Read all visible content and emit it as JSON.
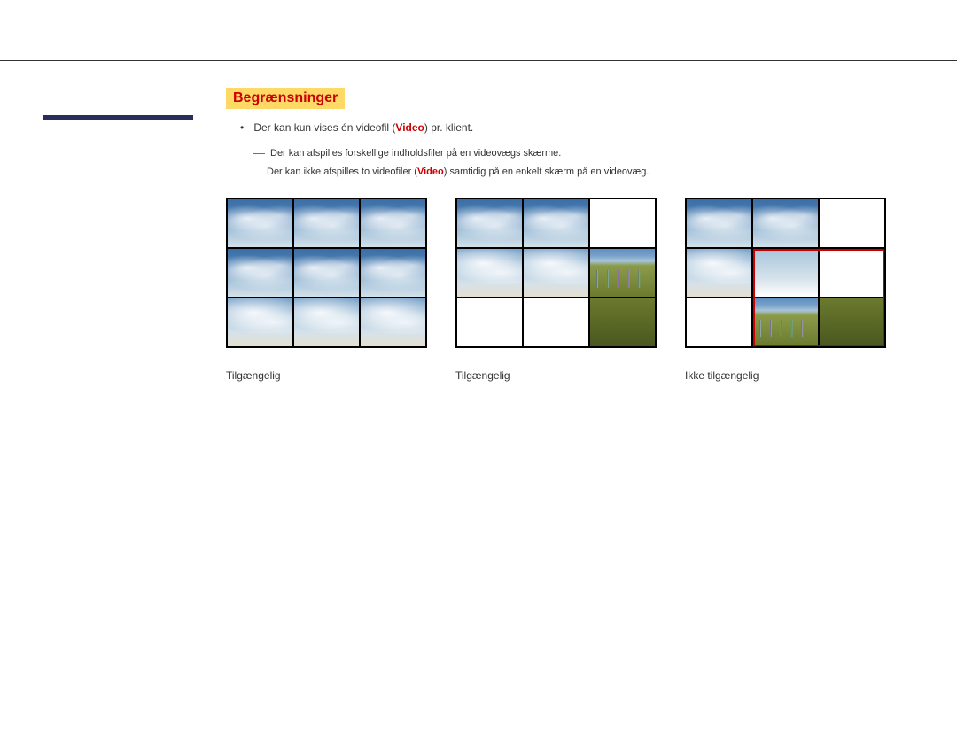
{
  "section_title": "Begrænsninger",
  "bullet": {
    "prefix": "Der kan kun vises én videofil (",
    "highlight": "Video",
    "suffix": ") pr. klient."
  },
  "sublist": {
    "line1": "Der kan afspilles forskellige indholdsfiler på en videovægs skærme.",
    "line2_prefix": "Der kan ikke afspilles to videofiler (",
    "line2_highlight": "Video",
    "line2_suffix": ") samtidig på en enkelt skærm på en videovæg."
  },
  "captions": {
    "fig1": "Tilgængelig",
    "fig2": "Tilgængelig",
    "fig3": "Ikke tilgængelig"
  }
}
